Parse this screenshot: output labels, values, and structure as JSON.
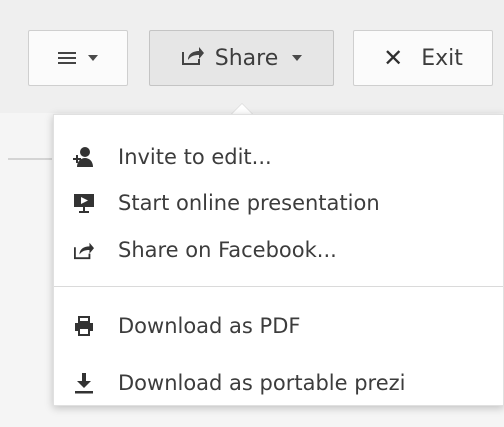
{
  "toolbar": {
    "menu_icon": "hamburger-icon",
    "share_label": "Share",
    "share_icon": "share-icon",
    "exit_label": "Exit",
    "exit_icon": "close-icon"
  },
  "share_menu": {
    "items": [
      {
        "label": "Invite to edit...",
        "icon": "add-user-icon"
      },
      {
        "label": "Start online presentation",
        "icon": "presentation-icon"
      },
      {
        "label": "Share on Facebook...",
        "icon": "share-icon"
      },
      {
        "label": "Download as PDF",
        "icon": "printer-icon"
      },
      {
        "label": "Download as portable prezi",
        "icon": "download-icon"
      }
    ]
  }
}
